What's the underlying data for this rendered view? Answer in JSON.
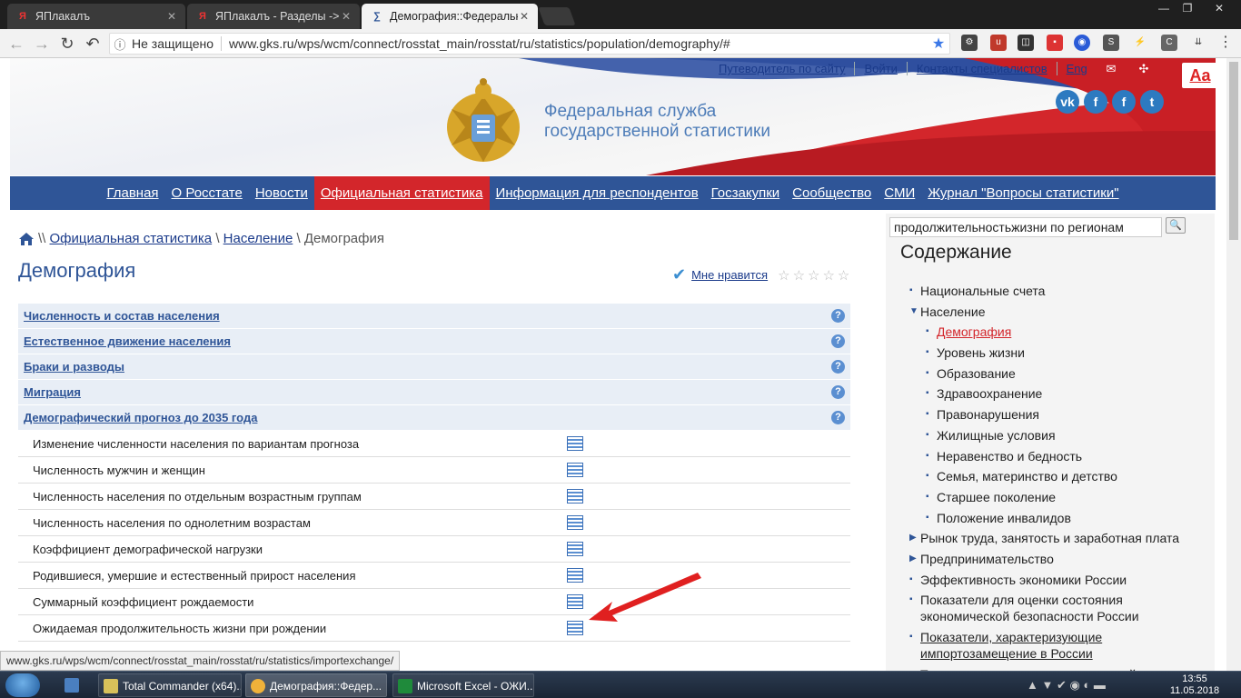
{
  "browser": {
    "tabs": [
      {
        "title": "ЯПлакалъ",
        "icon": "yaplakal-icon"
      },
      {
        "title": "ЯПлакалъ - Разделы -> ",
        "icon": "yaplakal-icon"
      },
      {
        "title": "Демография::Федеральна",
        "icon": "rosstat-icon"
      }
    ],
    "security_label": "Не защищено",
    "url": "www.gks.ru/wps/wcm/connect/rosstat_main/rosstat/ru/statistics/population/demography/#"
  },
  "site": {
    "top_links": [
      "Путеводитель по сайту",
      "Войти",
      "Контакты специалистов",
      "Eng"
    ],
    "font_size_button": "Aa",
    "org_name_line1": "Федеральная служба",
    "org_name_line2": "государственной статистики",
    "social": [
      "vk-icon",
      "facebook-icon",
      "facebook-icon",
      "twitter-icon"
    ],
    "main_nav": [
      "Главная",
      "О Росстате",
      "Новости",
      "Официальная статистика",
      "Информация для респондентов",
      "Госзакупки",
      "Сообщество",
      "СМИ",
      "Журнал \"Вопросы статистики\""
    ],
    "active_nav": "Официальная статистика"
  },
  "content": {
    "breadcrumb": {
      "sep": "\\\\",
      "link1": "Официальная статистика",
      "sep2": "\\",
      "link2": "Население",
      "sep3": "\\",
      "current": "Демография"
    },
    "title": "Демография",
    "like_label": "Мне нравится",
    "sections": [
      "Численность и состав населения",
      "Естественное движение населения",
      "Браки и разводы",
      "Миграция",
      "Демографический прогноз до 2035 года"
    ],
    "items": [
      "Изменение численности населения по вариантам прогноза",
      "Численность мужчин и женщин",
      "Численность населения по отдельным возрастным группам",
      "Численность населения по однолетним возрастам",
      "Коэффициент демографической нагрузки",
      "Родившиеся, умершие и естественный прирост населения",
      "Суммарный коэффициент рождаемости",
      "Ожидаемая продолжительность жизни при рождении"
    ],
    "status_url": "www.gks.ru/wps/wcm/connect/rosstat_main/rosstat/ru/statistics/importexchange/"
  },
  "sidebar": {
    "search_value": "продолжительностьжизни по регионам",
    "toc_title": "Содержание",
    "toc": [
      {
        "label": "Национальные счета",
        "level": 0,
        "bullet": "▪"
      },
      {
        "label": "Население",
        "level": 0,
        "bullet": "▼"
      },
      {
        "label": "Демография",
        "level": 1,
        "bullet": "▪",
        "style": "link"
      },
      {
        "label": "Уровень жизни",
        "level": 1,
        "bullet": "▪"
      },
      {
        "label": "Образование",
        "level": 1,
        "bullet": "▪"
      },
      {
        "label": "Здравоохранение",
        "level": 1,
        "bullet": "▪"
      },
      {
        "label": "Правонарушения",
        "level": 1,
        "bullet": "▪"
      },
      {
        "label": "Жилищные условия",
        "level": 1,
        "bullet": "▪"
      },
      {
        "label": "Неравенство и бедность",
        "level": 1,
        "bullet": "▪"
      },
      {
        "label": "Семья, материнство и детство",
        "level": 1,
        "bullet": "▪"
      },
      {
        "label": "Старшее поколение",
        "level": 1,
        "bullet": "▪"
      },
      {
        "label": "Положение инвалидов",
        "level": 1,
        "bullet": "▪"
      },
      {
        "label": "Рынок труда, занятость и заработная плата",
        "level": 0,
        "bullet": "▶"
      },
      {
        "label": "Предпринимательство",
        "level": 0,
        "bullet": "▶"
      },
      {
        "label": "Эффективность экономики России",
        "level": 0,
        "bullet": "▪"
      },
      {
        "label": "Показатели для оценки состояния экономической безопасности России",
        "level": 0,
        "bullet": "▪"
      },
      {
        "label": "Показатели, характеризующие импортозамещение в России",
        "level": 0,
        "bullet": "▪",
        "style": "ul"
      },
      {
        "label": "Технологическое развитие отраслей",
        "level": 0,
        "bullet": "▪"
      }
    ]
  },
  "taskbar": {
    "items": [
      {
        "label": "Total Commander (x64)...",
        "icon": "total-commander-icon",
        "color": "#d8c15a"
      },
      {
        "label": "Демография::Федер...",
        "icon": "chrome-icon",
        "color": "#f0b23a"
      },
      {
        "label": "Microsoft Excel - ОЖИ...",
        "icon": "excel-icon",
        "color": "#1f8a3b"
      }
    ],
    "time": "13:55",
    "date": "11.05.2018"
  },
  "colors": {
    "nav_blue": "#2f5597",
    "active_red": "#d3262b",
    "link_blue": "#1a3a8a"
  }
}
